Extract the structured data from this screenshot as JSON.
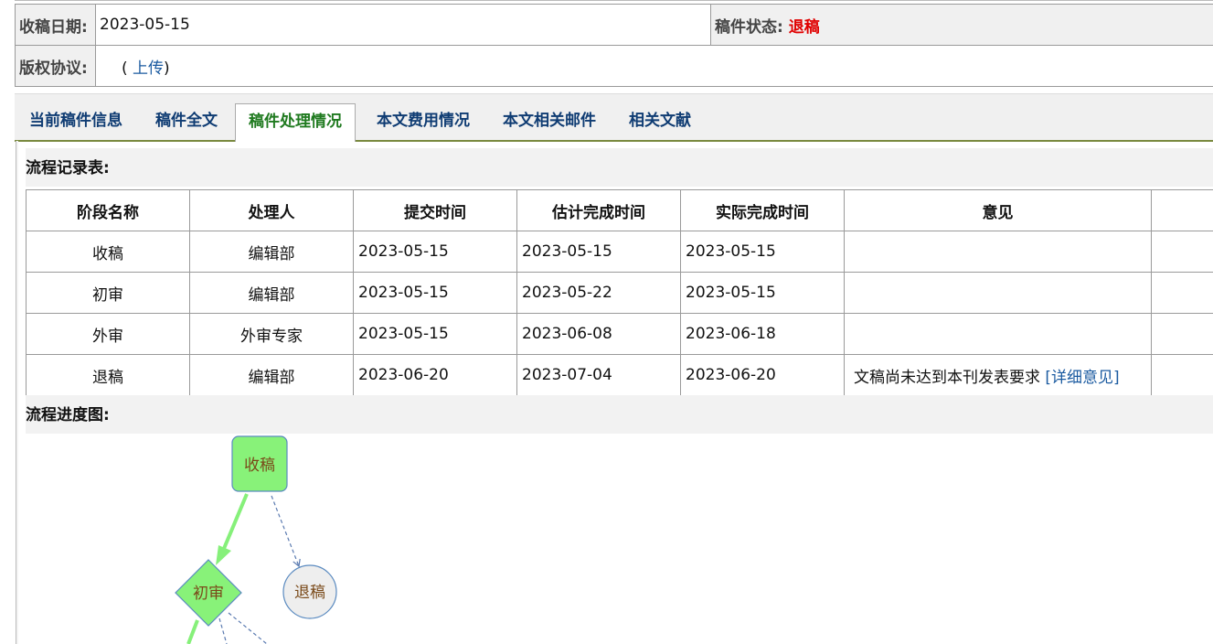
{
  "info": {
    "receive_date_label": "收稿日期:",
    "receive_date_value": "2023-05-15",
    "status_label": "稿件状态:",
    "status_value": "退稿",
    "copyright_label": "版权协议:",
    "copyright_prefix": "(",
    "copyright_link": "上传",
    "copyright_suffix": ")"
  },
  "tabs": [
    {
      "label": "当前稿件信息"
    },
    {
      "label": "稿件全文"
    },
    {
      "label": "稿件处理情况"
    },
    {
      "label": "本文费用情况"
    },
    {
      "label": "本文相关邮件"
    },
    {
      "label": "相关文献"
    }
  ],
  "flow_record": {
    "title": "流程记录表:",
    "headers": [
      "阶段名称",
      "处理人",
      "提交时间",
      "估计完成时间",
      "实际完成时间",
      "意见"
    ],
    "rows": [
      {
        "stage": "收稿",
        "handler": "编辑部",
        "submit": "2023-05-15",
        "estimated": "2023-05-15",
        "actual": "2023-05-15",
        "opinion": "",
        "link": ""
      },
      {
        "stage": "初审",
        "handler": "编辑部",
        "submit": "2023-05-15",
        "estimated": "2023-05-22",
        "actual": "2023-05-15",
        "opinion": "",
        "link": ""
      },
      {
        "stage": "外审",
        "handler": "外审专家",
        "submit": "2023-05-15",
        "estimated": "2023-06-08",
        "actual": "2023-06-18",
        "opinion": "",
        "link": ""
      },
      {
        "stage": "退稿",
        "handler": "编辑部",
        "submit": "2023-06-20",
        "estimated": "2023-07-04",
        "actual": "2023-06-20",
        "opinion": "文稿尚未达到本刊发表要求",
        "link": "[详细意见]"
      }
    ]
  },
  "flow_chart": {
    "title": "流程进度图:",
    "nodes": {
      "receive": "收稿",
      "first_review": "初审",
      "reject": "退稿"
    },
    "colors": {
      "node_fill": "#88f279",
      "node_stroke": "#5a8ac0",
      "reject_fill": "#eeeeee",
      "arrow_active": "#86f07a",
      "arrow_dashed": "#5a7ab0"
    }
  }
}
